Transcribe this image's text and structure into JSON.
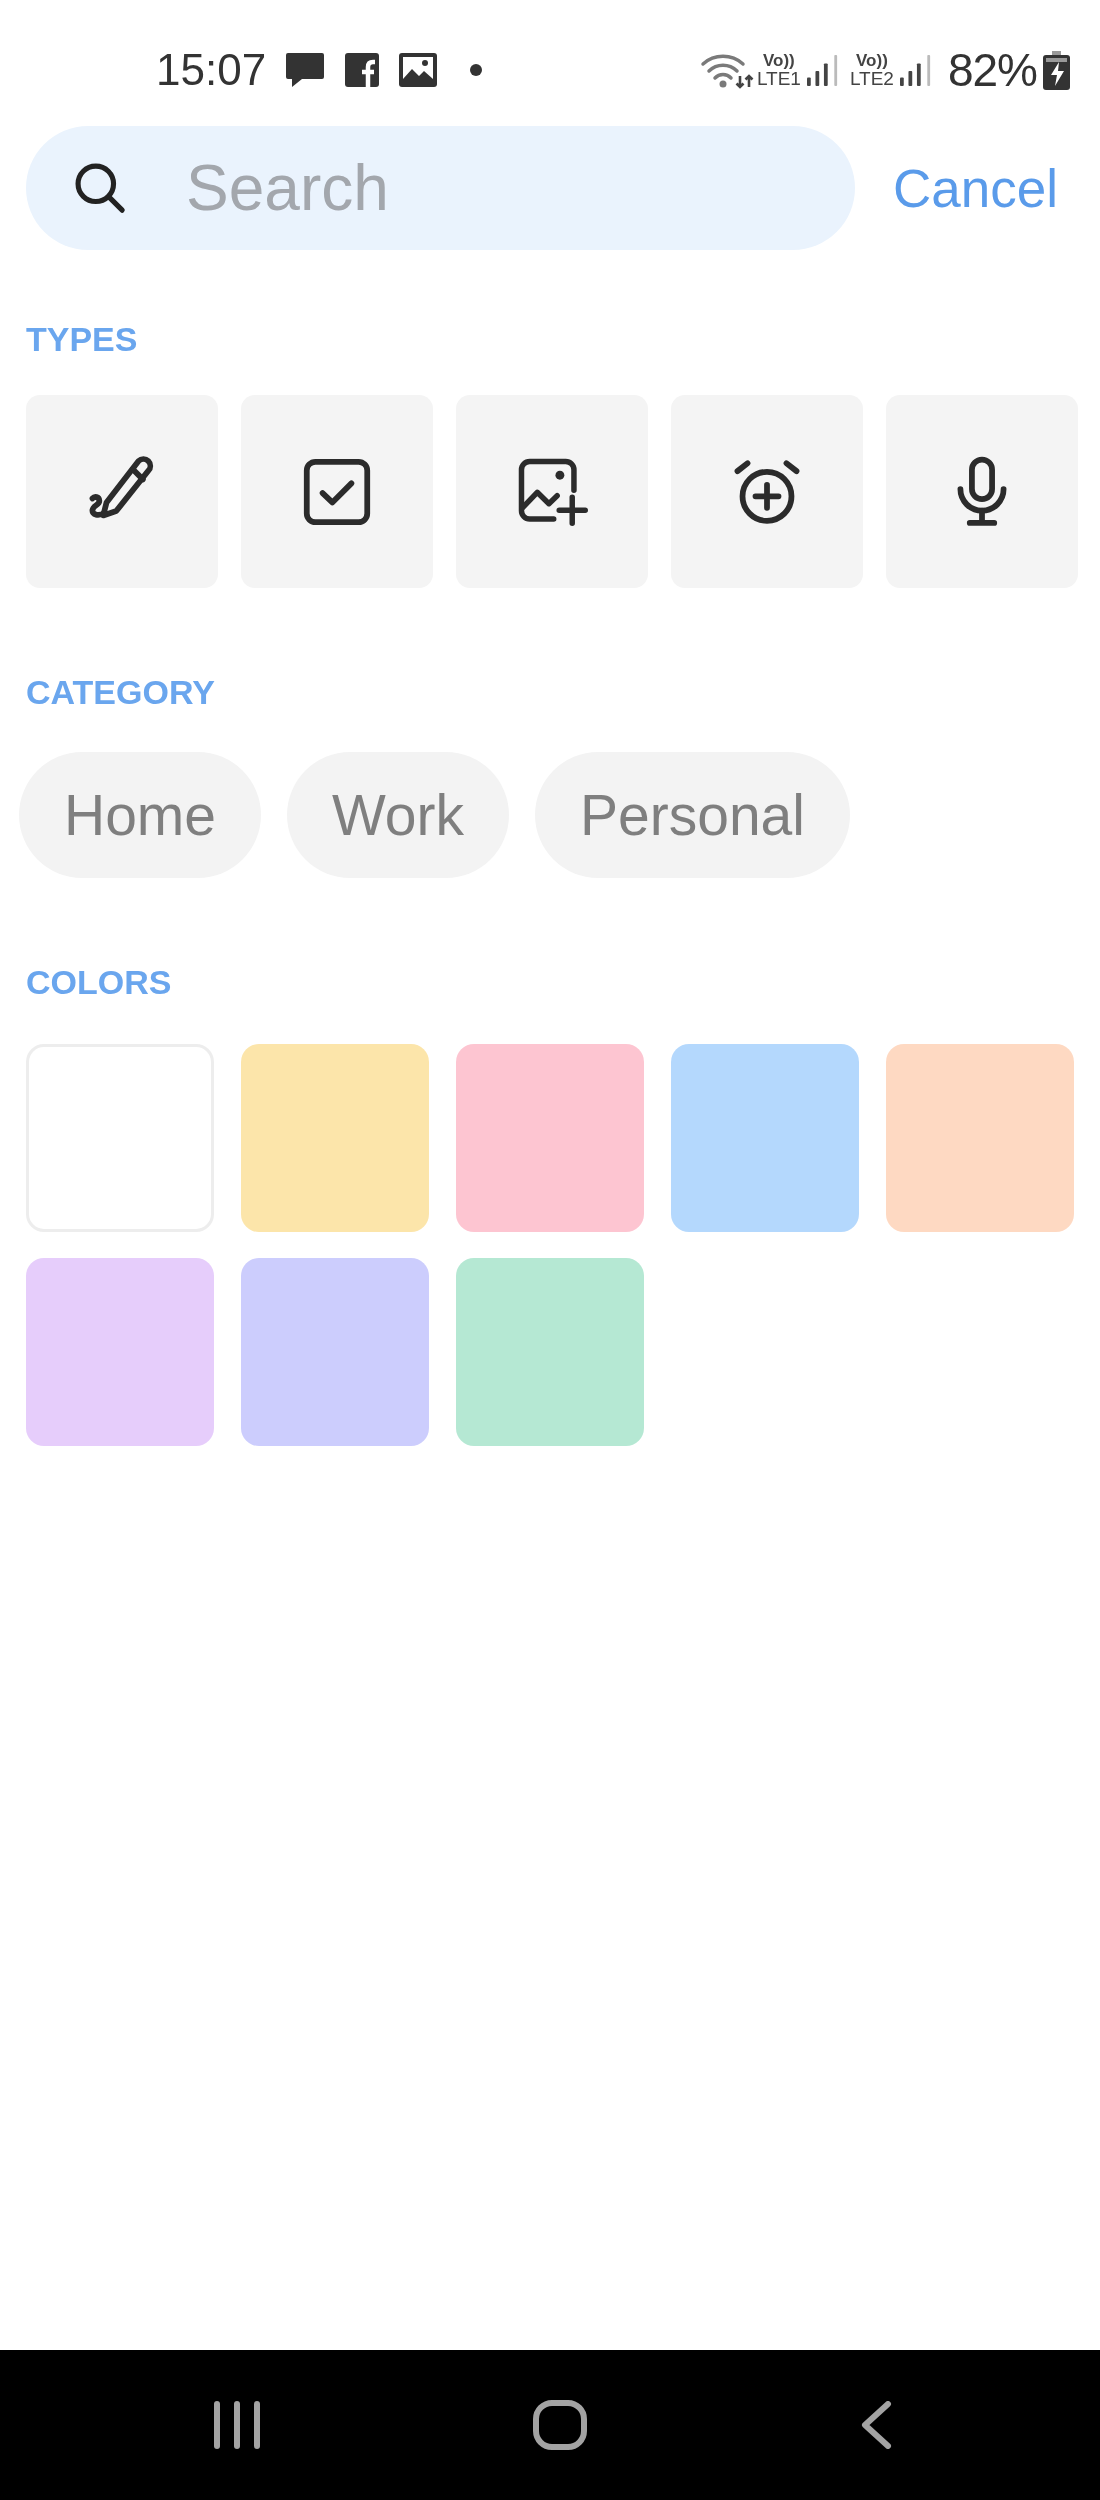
{
  "status_bar": {
    "time": "15:07",
    "sim_slots": [
      {
        "volte": "Vo))",
        "network": "LTE1"
      },
      {
        "volte": "Vo))",
        "network": "LTE2"
      }
    ],
    "battery": "82%"
  },
  "search": {
    "placeholder": "Search",
    "cancel": "Cancel"
  },
  "types": {
    "title": "TYPES",
    "items": [
      {
        "kind": "drawing",
        "selected": false
      },
      {
        "kind": "checklist",
        "selected": false
      },
      {
        "kind": "image",
        "selected": false
      },
      {
        "kind": "reminder",
        "selected": false
      },
      {
        "kind": "audio",
        "selected": false
      }
    ]
  },
  "category": {
    "title": "CATEGORY",
    "chips": [
      {
        "label": "Home",
        "selected": false
      },
      {
        "label": "Work",
        "selected": false
      },
      {
        "label": "Personal",
        "selected": false
      }
    ]
  },
  "colors": {
    "title": "COLORS",
    "swatches": [
      {
        "color": "#ffffff",
        "selected": false
      },
      {
        "color": "#fce5aa",
        "selected": false
      },
      {
        "color": "#fdc5d1",
        "selected": false
      },
      {
        "color": "#b4d8fd",
        "selected": false
      },
      {
        "color": "#fed9c2",
        "selected": false
      },
      {
        "color": "#e6cdfb",
        "selected": false
      },
      {
        "color": "#cccdfd",
        "selected": false
      },
      {
        "color": "#b5e8d3",
        "selected": false
      }
    ]
  }
}
